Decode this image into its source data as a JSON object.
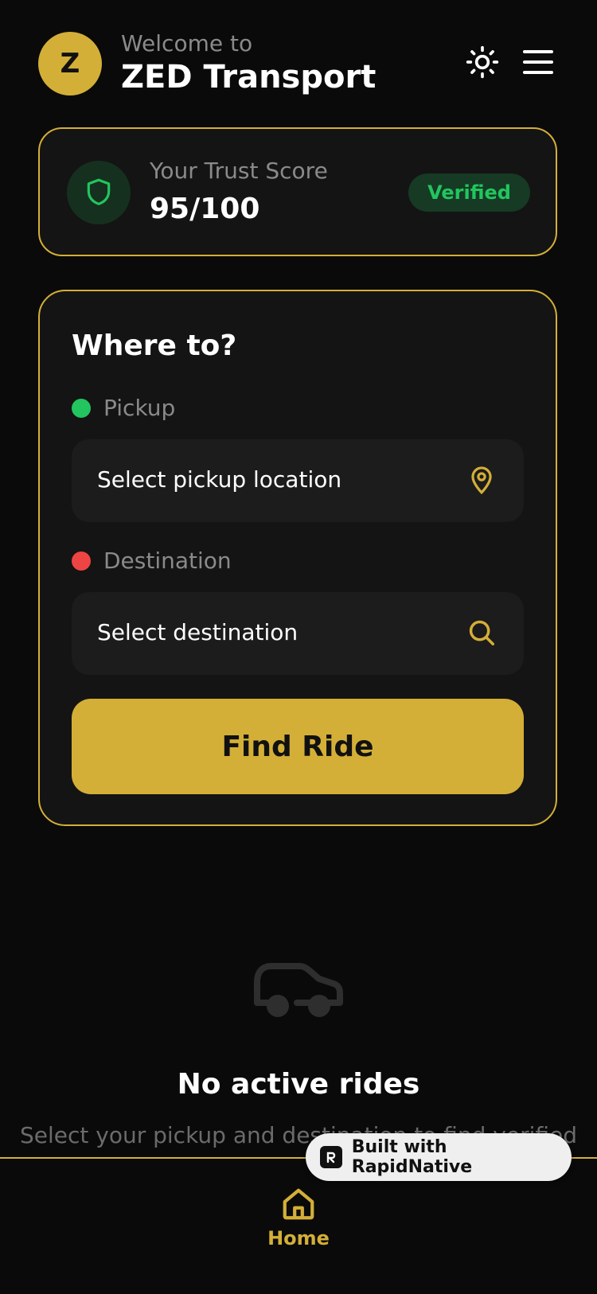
{
  "header": {
    "avatar_letter": "Z",
    "welcome": "Welcome to",
    "title": "ZED Transport",
    "theme_icon": "sun-icon",
    "menu_icon": "hamburger-menu-icon"
  },
  "trust": {
    "label": "Your Trust Score",
    "score": "95/100",
    "badge": "Verified",
    "icon": "shield-icon"
  },
  "search": {
    "title": "Where to?",
    "pickup_label": "Pickup",
    "pickup_placeholder": "Select pickup location",
    "destination_label": "Destination",
    "destination_placeholder": "Select destination",
    "find_button": "Find Ride"
  },
  "empty_state": {
    "icon": "car-icon",
    "title": "No active rides",
    "subtitle": "Select your pickup and destination to find verified"
  },
  "tab_bar": {
    "home_label": "Home",
    "home_icon": "home-icon"
  },
  "badge": {
    "label": "Built with RapidNative"
  },
  "colors": {
    "accent": "#d4af37",
    "background": "#0a0a0a",
    "card": "#141414",
    "success": "#22c55e",
    "danger": "#ef4444"
  }
}
